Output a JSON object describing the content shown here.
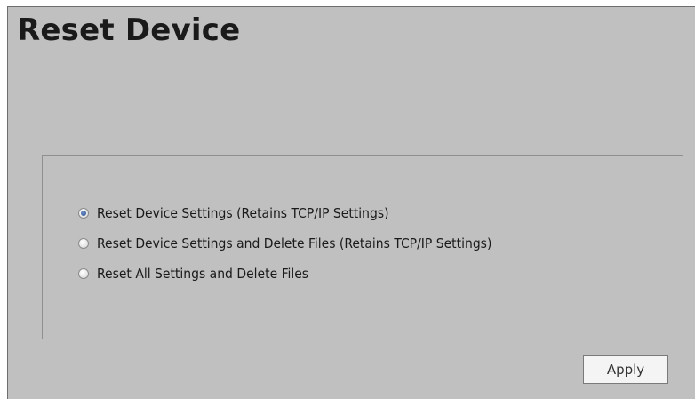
{
  "page": {
    "title": "Reset Device"
  },
  "reset_options": {
    "selected_index": 0,
    "items": [
      {
        "label": "Reset Device Settings (Retains TCP/IP Settings)",
        "checked": true
      },
      {
        "label": "Reset Device Settings and Delete Files (Retains TCP/IP Settings)",
        "checked": false
      },
      {
        "label": "Reset All Settings and Delete Files",
        "checked": false
      }
    ]
  },
  "actions": {
    "apply_label": "Apply"
  },
  "colors": {
    "background": "#c0c0c0",
    "radio_selected": "#2a4f8f"
  },
  "icons": {
    "radio_selected": "radio-checked-icon",
    "radio_unselected": "radio-unchecked-icon"
  }
}
